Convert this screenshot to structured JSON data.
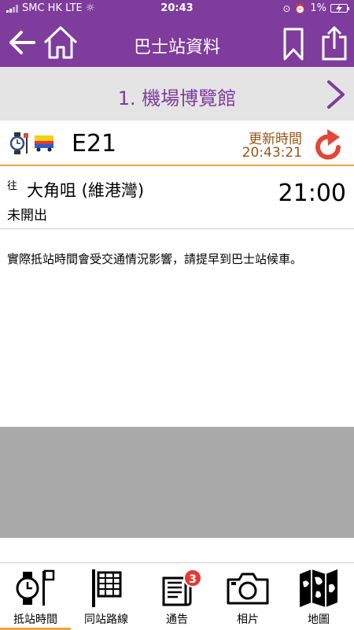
{
  "status_bar": {
    "carrier": "SMC HK  LTE ☼",
    "time": "20:43",
    "battery": "1%"
  },
  "header": {
    "title": "巴士站資料"
  },
  "stop": {
    "name": "1. 機場博覽館"
  },
  "route": {
    "number": "E21",
    "updated_label": "更新時間",
    "updated_time": "20:43:21"
  },
  "eta": {
    "to_label": "往",
    "destination": "大角咀 (維港灣)",
    "status": "未開出",
    "time": "21:00"
  },
  "note": "實際抵站時間會受交通情況影響，請提早到巴士站候車。",
  "tabs": [
    {
      "label": "抵站時間",
      "icon": "clock-stop-icon",
      "active": true
    },
    {
      "label": "同站路線",
      "icon": "route-board-icon",
      "active": false
    },
    {
      "label": "通告",
      "icon": "notice-icon",
      "active": false,
      "badge": "3"
    },
    {
      "label": "相片",
      "icon": "camera-icon",
      "active": false
    },
    {
      "label": "地圖",
      "icon": "map-icon",
      "active": false
    }
  ],
  "colors": {
    "brand_purple": "#7e3c9c",
    "accent_orange": "#f2a23e",
    "update_brown": "#9b5416",
    "refresh_red": "#e0483a",
    "ad_gray": "#a9a9a9"
  }
}
